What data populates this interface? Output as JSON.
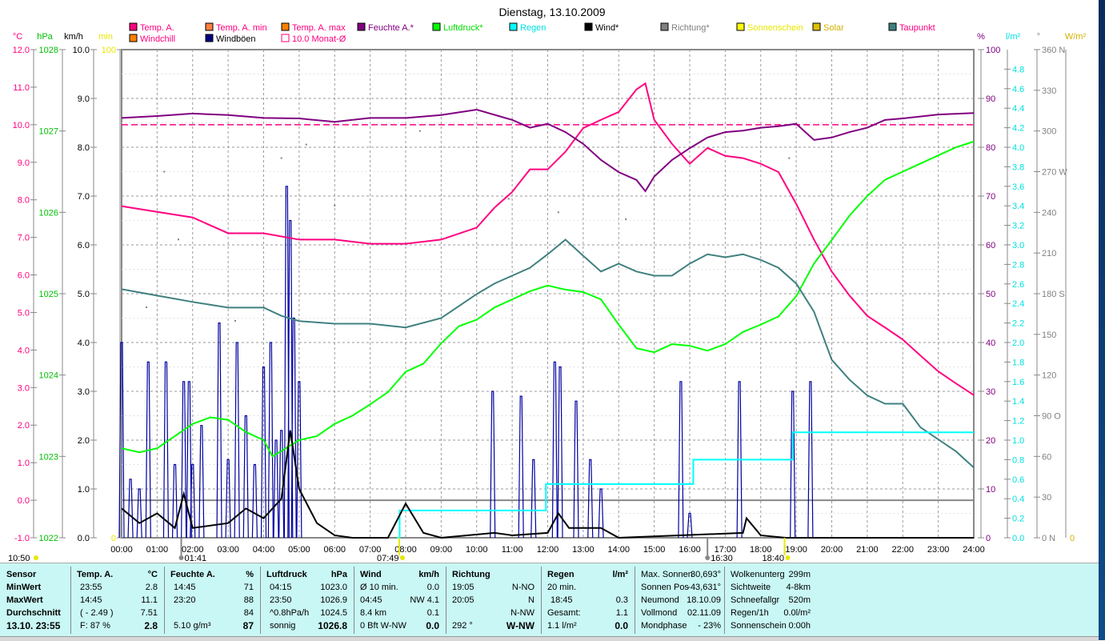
{
  "title": "Dienstag, 13.10.2009",
  "legend": [
    {
      "label": "Temp. A.",
      "color": "#ff0080",
      "text_color": "#ff0080"
    },
    {
      "label": "Temp. A. min",
      "color": "#ff8040",
      "text_color": "#ff0080"
    },
    {
      "label": "Temp. A. max",
      "color": "#ff8000",
      "text_color": "#ff0080"
    },
    {
      "label": "Feuchte A.*",
      "color": "#800080",
      "text_color": "#800080"
    },
    {
      "label": "Luftdruck*",
      "color": "#00ff00",
      "text_color": "#00dd00"
    },
    {
      "label": "Regen",
      "color": "#00ffff",
      "text_color": "#00e0e0"
    },
    {
      "label": "Wind*",
      "color": "#000000",
      "text_color": "#000000"
    },
    {
      "label": "Richtung*",
      "color": "#808080",
      "text_color": "#808080"
    },
    {
      "label": "Sonnenschein",
      "color": "#ffff00",
      "text_color": "#e8e800"
    },
    {
      "label": "Solar",
      "color": "#e0c000",
      "text_color": "#d4b000"
    },
    {
      "label": "Taupunkt",
      "color": "#408080",
      "text_color": "#ff0080"
    },
    {
      "label": "Windchill",
      "color": "#ff8000",
      "text_color": "#ff0080"
    },
    {
      "label": "Windböen",
      "color": "#000080",
      "text_color": "#000000"
    },
    {
      "label": "10.0 Monat-Ø",
      "color": "#ff0080",
      "text_color": "#ff0080"
    }
  ],
  "axis_units": {
    "celsius": "°C",
    "hpa": "hPa",
    "kmh": "km/h",
    "min": "min",
    "percent": "%",
    "rain": "l/m²",
    "degree": "°",
    "solar": "W/m²"
  },
  "chart_data": {
    "type": "line",
    "title": "Dienstag, 13.10.2009",
    "x_unit": "hour",
    "x_ticks": [
      "00:00",
      "01:00",
      "02:00",
      "03:00",
      "04:00",
      "05:00",
      "06:00",
      "07:00",
      "08:00",
      "09:00",
      "10:00",
      "11:00",
      "12:00",
      "13:00",
      "14:00",
      "15:00",
      "16:00",
      "17:00",
      "18:00",
      "19:00",
      "20:00",
      "21:00",
      "22:00",
      "23:00",
      "24:00"
    ],
    "axes": {
      "celsius": {
        "range": [
          -1,
          12
        ],
        "ticks": [
          "12.0",
          "11.0",
          "10.0",
          "9.0",
          "8.0",
          "7.0",
          "6.0",
          "5.0",
          "4.0",
          "3.0",
          "2.0",
          "1.0",
          "0.0",
          "-1.0"
        ],
        "color": "#ff0080"
      },
      "hpa": {
        "range": [
          1022,
          1028
        ],
        "ticks": [
          "1028",
          "1027",
          "1026",
          "1025",
          "1024",
          "1023",
          "1022"
        ],
        "color": "#00c000"
      },
      "kmh": {
        "range": [
          0,
          10
        ],
        "ticks": [
          "10.0",
          "9.0",
          "8.0",
          "7.0",
          "6.0",
          "5.0",
          "4.0",
          "3.0",
          "2.0",
          "1.0",
          "0.0"
        ],
        "color": "#000000"
      },
      "min": {
        "range": [
          0,
          100
        ],
        "ticks": [
          "100",
          "0"
        ],
        "color": "#ffff00"
      },
      "percent": {
        "range": [
          0,
          100
        ],
        "ticks": [
          "100",
          "90",
          "80",
          "70",
          "60",
          "50",
          "40",
          "30",
          "20",
          "10",
          "0"
        ],
        "color": "#800080"
      },
      "rain": {
        "range": [
          0,
          5
        ],
        "ticks": [
          "4.8",
          "4.6",
          "4.4",
          "4.2",
          "4.0",
          "3.8",
          "3.6",
          "3.4",
          "3.2",
          "3.0",
          "2.8",
          "2.6",
          "2.4",
          "2.2",
          "2.0",
          "1.8",
          "1.6",
          "1.4",
          "1.2",
          "1.0",
          "0.8",
          "0.6",
          "0.4",
          "0.2",
          "0.0"
        ],
        "color": "#00e8e8"
      },
      "degree": {
        "range": [
          0,
          360
        ],
        "ticks": [
          "360 N",
          "330",
          "300",
          "270 W",
          "240",
          "210",
          "180 S",
          "150",
          "120",
          "90  O",
          "60",
          "30",
          "0    N"
        ],
        "color": "#808080"
      },
      "solar": {
        "ticks": [
          "0"
        ],
        "color": "#d4b000"
      }
    },
    "monthly_avg_temp": 10.0,
    "series": [
      {
        "name": "Temp. A.",
        "axis": "celsius",
        "color": "#ff0080",
        "x": [
          0,
          1,
          2,
          3,
          4,
          5,
          6,
          7,
          8,
          9,
          10,
          10.5,
          11,
          11.5,
          12,
          12.5,
          13,
          13.5,
          14,
          14.5,
          14.75,
          15,
          15.5,
          16,
          16.5,
          17,
          17.5,
          18,
          18.5,
          19,
          19.5,
          20,
          20.5,
          21,
          21.5,
          22,
          22.5,
          23,
          23.5,
          24
        ],
        "y": [
          7.83,
          7.68,
          7.53,
          7.11,
          7.11,
          6.94,
          6.94,
          6.83,
          6.83,
          6.94,
          7.26,
          7.79,
          8.21,
          8.81,
          8.81,
          9.28,
          9.91,
          10.13,
          10.34,
          10.94,
          11.1,
          10.13,
          9.49,
          8.96,
          9.38,
          9.17,
          9.11,
          8.96,
          8.74,
          7.89,
          6.94,
          6.09,
          5.45,
          4.91,
          4.6,
          4.28,
          3.85,
          3.43,
          3.11,
          2.8
        ]
      },
      {
        "name": "Feuchte A.",
        "axis": "percent",
        "color": "#800080",
        "x": [
          0,
          1,
          2,
          3,
          4,
          5,
          6,
          7,
          8,
          9,
          10,
          11,
          11.5,
          12,
          12.5,
          13,
          13.5,
          14,
          14.5,
          14.75,
          15,
          15.5,
          16,
          16.5,
          17,
          17.5,
          18,
          18.5,
          19,
          19.5,
          20,
          20.5,
          21,
          21.5,
          22,
          23,
          24
        ],
        "y": [
          86,
          86.4,
          86.9,
          86.6,
          86,
          85.9,
          85.2,
          86,
          86,
          86.6,
          87.7,
          85.6,
          84,
          84.8,
          83.1,
          80.7,
          77.4,
          74.9,
          73.3,
          71,
          74,
          77.4,
          79.8,
          82,
          83.1,
          83.4,
          84,
          84.3,
          84.8,
          81.5,
          82,
          83.1,
          84,
          85.6,
          85.9,
          86.7,
          87
        ]
      },
      {
        "name": "Luftdruck",
        "axis": "hpa",
        "color": "#00ff00",
        "x": [
          0,
          0.5,
          1,
          1.5,
          2,
          2.5,
          3,
          3.5,
          4,
          4.25,
          5,
          5.5,
          6,
          6.5,
          7,
          7.5,
          8,
          8.5,
          9,
          9.5,
          10,
          10.5,
          11,
          11.5,
          12,
          12.5,
          13,
          13.5,
          14,
          14.5,
          15,
          15.5,
          16,
          16.5,
          17,
          17.5,
          18,
          18.5,
          19,
          19.5,
          20,
          20.5,
          21,
          21.5,
          22,
          22.5,
          23,
          23.5,
          24
        ],
        "y": [
          1023.1,
          1023.05,
          1023.1,
          1023.25,
          1023.4,
          1023.48,
          1023.45,
          1023.3,
          1023.2,
          1023.0,
          1023.2,
          1023.25,
          1023.4,
          1023.5,
          1023.64,
          1023.79,
          1024.04,
          1024.14,
          1024.39,
          1024.6,
          1024.68,
          1024.83,
          1024.93,
          1025.03,
          1025.1,
          1025.05,
          1025.02,
          1024.93,
          1024.62,
          1024.33,
          1024.28,
          1024.38,
          1024.36,
          1024.3,
          1024.38,
          1024.53,
          1024.62,
          1024.72,
          1024.97,
          1025.37,
          1025.66,
          1025.96,
          1026.2,
          1026.4,
          1026.5,
          1026.6,
          1026.7,
          1026.8,
          1026.87
        ]
      },
      {
        "name": "Taupunkt",
        "axis": "celsius",
        "color": "#408080",
        "x": [
          0,
          1,
          2,
          3,
          4,
          4.5,
          5,
          6,
          7,
          8,
          9,
          10,
          10.5,
          11,
          11.5,
          12,
          12.5,
          13,
          13.5,
          14,
          14.5,
          15,
          15.5,
          16,
          16.5,
          17,
          17.5,
          18,
          18.5,
          19,
          19.5,
          20,
          20.5,
          21,
          21.5,
          22,
          22.5,
          23,
          23.5,
          24
        ],
        "y": [
          5.62,
          5.45,
          5.28,
          5.13,
          5.13,
          4.91,
          4.77,
          4.7,
          4.7,
          4.6,
          4.85,
          5.49,
          5.77,
          5.98,
          6.19,
          6.55,
          6.94,
          6.51,
          6.09,
          6.3,
          6.09,
          5.98,
          5.98,
          6.3,
          6.55,
          6.47,
          6.55,
          6.4,
          6.19,
          5.77,
          5.02,
          3.74,
          3.21,
          2.79,
          2.57,
          2.57,
          1.94,
          1.62,
          1.3,
          0.87
        ]
      },
      {
        "name": "Regen",
        "axis": "rain",
        "color": "#00ffff",
        "step": true,
        "x": [
          7.75,
          7.83,
          11.9,
          11.95,
          16.05,
          16.1,
          18.83,
          18.9,
          24
        ],
        "y": [
          0,
          0.28,
          0.28,
          0.55,
          0.55,
          0.8,
          0.8,
          1.08,
          1.08
        ]
      },
      {
        "name": "Wind",
        "axis": "kmh",
        "color": "#000000",
        "x": [
          0,
          0.5,
          1,
          1.5,
          1.75,
          2,
          3,
          3.5,
          4,
          4.5,
          4.75,
          5,
          5.5,
          6,
          6.5,
          7.5,
          8,
          8.5,
          9,
          10.5,
          11,
          12,
          12.3,
          12.6,
          13.5,
          14,
          17.5,
          17.6,
          18,
          18.7,
          24
        ],
        "y": [
          0.6,
          0.3,
          0.5,
          0.2,
          0.9,
          0.2,
          0.3,
          0.6,
          0.4,
          0.8,
          2.2,
          1.0,
          0.3,
          0.05,
          0,
          0,
          0.7,
          0.1,
          0,
          0.1,
          0.05,
          0.1,
          0.5,
          0.2,
          0.2,
          0,
          0.1,
          0.4,
          0.05,
          0,
          0
        ]
      }
    ],
    "gusts": {
      "name": "Windböen",
      "axis": "kmh",
      "color": "#0000a0",
      "x": [
        0,
        0.25,
        0.5,
        0.75,
        1.25,
        1.5,
        1.75,
        1.9,
        2.0,
        2.25,
        2.75,
        3.0,
        3.25,
        3.5,
        3.75,
        4.0,
        4.2,
        4.35,
        4.5,
        4.65,
        4.75,
        4.85,
        5.0,
        10.45,
        11.25,
        11.6,
        12.2,
        12.35,
        12.8,
        13.2,
        13.5,
        15.75,
        16.0,
        17.4,
        18.9,
        19.4
      ],
      "y": [
        4.0,
        1.2,
        1.0,
        3.6,
        3.6,
        1.5,
        3.2,
        3.2,
        1.5,
        2.3,
        4.4,
        1.6,
        4.0,
        2.5,
        1.5,
        3.5,
        4.0,
        2.0,
        2.2,
        7.2,
        6.5,
        4.5,
        3.2,
        3.0,
        2.9,
        1.6,
        3.6,
        3.5,
        2.8,
        1.6,
        1.0,
        3.2,
        0.5,
        3.2,
        3.0,
        3.2
      ]
    },
    "direction_points": {
      "axis": "degree",
      "color": "#808080",
      "x": [
        0.7,
        1.2,
        1.6,
        3.2,
        4.0,
        4.5,
        5.2,
        6.0,
        8.4,
        10.9,
        12.3,
        14.2,
        18.8
      ],
      "y": [
        170,
        270,
        220,
        160,
        170,
        280,
        290,
        245,
        300,
        250,
        240,
        235,
        280
      ]
    },
    "time_markers": [
      {
        "label": "10:50",
        "x": 0,
        "kind": "sun"
      },
      {
        "label": "01:41",
        "x": 1.68,
        "kind": "moonrise"
      },
      {
        "label": "07:49",
        "x": 7.82,
        "kind": "sunrise"
      },
      {
        "label": "16:30",
        "x": 16.5,
        "kind": "moonset"
      },
      {
        "label": "18:40",
        "x": 18.67,
        "kind": "sunset"
      }
    ]
  },
  "table": {
    "sensor": {
      "header": "Sensor",
      "rows": [
        "MinWert",
        "MaxWert",
        "Durchschnitt",
        "13.10. 23:55"
      ]
    },
    "temp": {
      "header": "Temp. A.",
      "unit": "°C",
      "rows": [
        [
          "23:55",
          "2.8"
        ],
        [
          "14:45",
          "11.1"
        ],
        [
          "( - 2.49 )",
          "7.51"
        ],
        [
          "F: 87 %",
          "2.8"
        ]
      ]
    },
    "humidity": {
      "header": "Feuchte A.",
      "unit": "%",
      "rows": [
        [
          "14:45",
          "71"
        ],
        [
          "23:20",
          "88"
        ],
        [
          "",
          "84"
        ],
        [
          "5.10 g/m³",
          "87"
        ]
      ]
    },
    "pressure": {
      "header": "Luftdruck",
      "unit": "hPa",
      "rows": [
        [
          "04:15",
          "1023.0"
        ],
        [
          "23:50",
          "1026.9"
        ],
        [
          "^0.8hPa/h",
          "1024.5"
        ],
        [
          "sonnig",
          "1026.8"
        ]
      ]
    },
    "wind": {
      "header": "Wind",
      "unit": "km/h",
      "rows": [
        [
          "Ø 10 min.",
          "0.0"
        ],
        [
          "04:45",
          "NW 4.1"
        ],
        [
          "8.4 km",
          "0.1"
        ],
        [
          "0 Bft W-NW",
          "0.0"
        ]
      ]
    },
    "direction": {
      "header": "Richtung",
      "unit": "",
      "rows": [
        [
          "19:05",
          "N-NO"
        ],
        [
          "20:05",
          "N"
        ],
        [
          "",
          "N-NW"
        ],
        [
          "292 °",
          "W-NW"
        ]
      ]
    },
    "rain": {
      "header": "Regen",
      "unit": "l/m²",
      "rows": [
        [
          "20 min.",
          ""
        ],
        [
          "18:45",
          "0.3"
        ],
        [
          "Gesamt:",
          "1.1"
        ],
        [
          "1.1 l/m²",
          "0.0"
        ]
      ]
    },
    "sun": {
      "rows": [
        [
          "Max. Sonnen",
          "30,693°"
        ],
        [
          "Sonnen Pos",
          "-43,631°"
        ],
        [
          "Neumond",
          "18.10.09"
        ],
        [
          "Vollmond",
          "02.11.09"
        ],
        [
          "Mondphase",
          "- 23%"
        ]
      ]
    },
    "misc": {
      "rows": [
        [
          "Wolkenunterg",
          "299m"
        ],
        [
          "Sichtweite",
          "4-8km"
        ],
        [
          "Schneefallgr",
          "520m"
        ],
        [
          "Regen/1h",
          "0.0l/m²"
        ],
        [
          "Sonnenschein",
          "0:00h"
        ]
      ]
    }
  }
}
